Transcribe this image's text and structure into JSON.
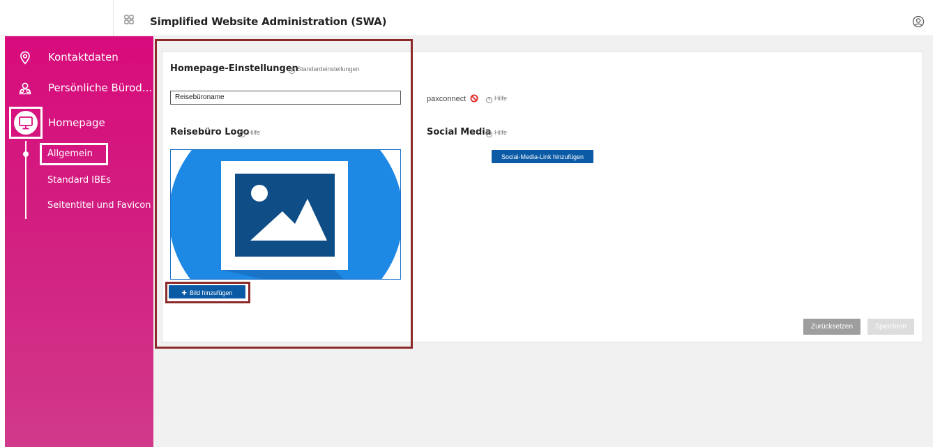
{
  "header": {
    "title": "Simplified Website Administration (SWA)",
    "apps_icon": "grid-icon",
    "user_icon": "user-circle-icon"
  },
  "sidebar": {
    "items": [
      {
        "label": "Kontaktdaten",
        "icon": "map-pin-icon"
      },
      {
        "label": "Persönliche Bürod...",
        "icon": "people-icon"
      },
      {
        "label": "Homepage",
        "icon": "monitor-icon"
      }
    ],
    "subitems": [
      {
        "label": "Allgemein",
        "active": true
      },
      {
        "label": "Standard IBEs"
      },
      {
        "label": "Seitentitel und Favicon"
      }
    ]
  },
  "settings": {
    "title": "Homepage-Einstellungen",
    "default_link": "Standardeinstellungen",
    "name_input_value": "Reisebüroname",
    "logo_title": "Reisebüro Logo",
    "help_label": "Hilfe",
    "add_image_label": "Bild hinzufügen"
  },
  "right": {
    "paxconnect_label": "paxconnect",
    "help_label": "Hilfe",
    "social_title": "Social Media",
    "social_help_label": "Hilfe",
    "add_social_label": "Social-Media-Link hinzufügen"
  },
  "actions": {
    "reset_label": "Zurücksetzen",
    "save_label": "Speichern"
  },
  "colors": {
    "sidebar": "#d80b7c",
    "primary_button": "#0a5aa6",
    "highlight": "#8c2a2a",
    "placeholder_blue": "#1e88e5",
    "placeholder_dark": "#0f4d86"
  }
}
